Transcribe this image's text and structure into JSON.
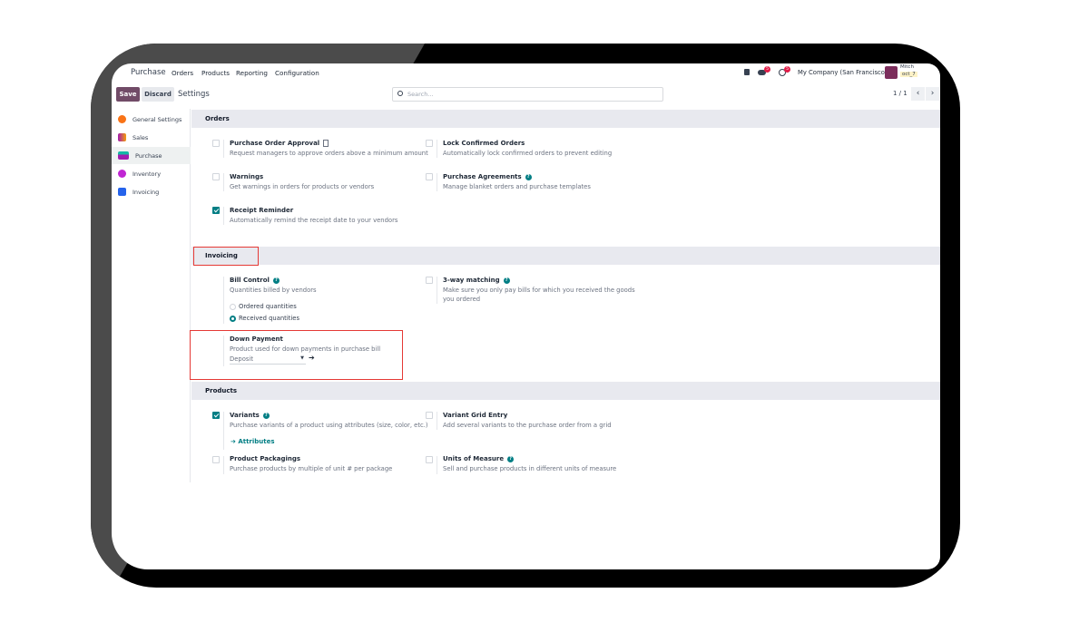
{
  "app": {
    "name": "Purchase",
    "menu": [
      "Orders",
      "Products",
      "Reporting",
      "Configuration"
    ]
  },
  "systray": {
    "messages_count": "5",
    "activities_count": "5",
    "company": "My Company (San Francisco)",
    "user": "Mitch",
    "db_badge": "oct_7"
  },
  "control": {
    "save": "Save",
    "discard": "Discard",
    "breadcrumb": "Settings",
    "search_placeholder": "Search...",
    "pager": "1 / 1"
  },
  "sidebar": {
    "items": [
      {
        "label": "General Settings",
        "color": "#f97316"
      },
      {
        "label": "Sales",
        "color": "#f59e0b"
      },
      {
        "label": "Purchase",
        "color": "#a21caf",
        "active": true
      },
      {
        "label": "Inventory",
        "color": "#c026d3"
      },
      {
        "label": "Invoicing",
        "color": "#2563eb"
      }
    ]
  },
  "orders": {
    "title": "Orders",
    "po_approval": {
      "title": "Purchase Order Approval",
      "desc": "Request managers to approve orders above a minimum amount",
      "checked": false
    },
    "lock": {
      "title": "Lock Confirmed Orders",
      "desc": "Automatically lock confirmed orders to prevent editing",
      "checked": false
    },
    "warnings": {
      "title": "Warnings",
      "desc": "Get warnings in orders for products or vendors",
      "checked": false
    },
    "agreements": {
      "title": "Purchase Agreements",
      "desc": "Manage blanket orders and purchase templates",
      "checked": false
    },
    "receipt": {
      "title": "Receipt Reminder",
      "desc": "Automatically remind the receipt date to your vendors",
      "checked": true
    }
  },
  "invoicing": {
    "title": "Invoicing",
    "bill_control": {
      "title": "Bill Control",
      "desc": "Quantities billed by vendors",
      "options": [
        "Ordered quantities",
        "Received quantities"
      ],
      "selected": "Received quantities"
    },
    "three_way": {
      "title": "3-way matching",
      "desc1": "Make sure you only pay bills for which you received the goods",
      "desc2": "you ordered",
      "checked": false
    },
    "down_payment": {
      "title": "Down Payment",
      "desc": "Product used for down payments in purchase bill",
      "value": "Deposit"
    }
  },
  "products": {
    "title": "Products",
    "variants": {
      "title": "Variants",
      "desc": "Purchase variants of a product using attributes (size, color, etc.)",
      "checked": true,
      "link": "Attributes"
    },
    "grid": {
      "title": "Variant Grid Entry",
      "desc": "Add several variants to the purchase order from a grid",
      "checked": false
    },
    "packagings": {
      "title": "Product Packagings",
      "desc": "Purchase products by multiple of unit # per package",
      "checked": false
    },
    "uom": {
      "title": "Units of Measure",
      "desc": "Sell and purchase products in different units of measure",
      "checked": false
    }
  },
  "colors": {
    "accent": "#017e84",
    "brand": "#714b67",
    "highlight": "#e53935"
  }
}
